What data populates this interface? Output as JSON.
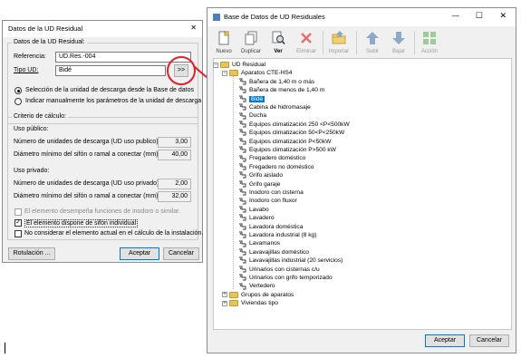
{
  "left_dialog": {
    "title": "Datos de la UD Residual",
    "close_glyph": "✕",
    "group_title": "Datos de la UD Residual:",
    "referencia_label": "Referencia:",
    "referencia_value": "UD.Res.-004",
    "tipo_label": "Tipo UD:",
    "tipo_value": "Bidé",
    "browse_label": ">>",
    "radio1": "Selección de la unidad de descarga desde la Base de datos",
    "radio2": "Indicar manualmente los parámetros de la unidad de descarga",
    "criterio_title": "Criterio de cálculo:",
    "uso_publico": "Uso público:",
    "pub_num_label": "Número de unidades de descarga (UD uso publico)",
    "pub_num_value": "3,00",
    "pub_diam_label": "Diámetro mínimo del sifón o ramal a conectar (mm):",
    "pub_diam_value": "40,00",
    "uso_privado": "Uso privado:",
    "priv_num_label": "Número de unidades de descarga (UD uso privado)",
    "priv_num_value": "2,00",
    "priv_diam_label": "Diámetro mínimo del sifón o ramal a conectar (mm):",
    "priv_diam_value": "32,00",
    "chk1": "El elemento desempeña funciones de inodoro o similar.",
    "chk2": "El elemento dispone de sifón individual",
    "chk3": "No considerar el elemento actual en el cálculo de la instalación.",
    "rotulacion": "Rotulación ...",
    "aceptar": "Aceptar",
    "cancelar": "Cancelar"
  },
  "right_dialog": {
    "title": "Base de Datos de UD Residuales",
    "win_min": "—",
    "win_max": "☐",
    "win_close": "✕",
    "toolbar": [
      {
        "label": "Nuevo",
        "icon": "new-doc-icon",
        "enabled": true
      },
      {
        "label": "Duplicar",
        "icon": "duplicate-icon",
        "enabled": true
      },
      {
        "label": "Ver",
        "icon": "magnifier-icon",
        "enabled": true
      },
      {
        "label": "Eliminar",
        "icon": "delete-x-icon",
        "enabled": false
      },
      {
        "label": "Importar",
        "icon": "import-folder-icon",
        "enabled": false
      },
      {
        "label": "Subir",
        "icon": "arrow-up-icon",
        "enabled": false
      },
      {
        "label": "Bajar",
        "icon": "arrow-down-icon",
        "enabled": false
      },
      {
        "label": "Acción",
        "icon": "action-grid-icon",
        "enabled": false
      }
    ],
    "tree_root": "UD Residual",
    "tree_group_open": "Aparatos CTE-HS4",
    "tree_items": [
      "Bañera de 1,40 m o más",
      "Bañera de menos de 1,40 m",
      "Bidé",
      "Cabina de hidromasaje",
      "Ducha",
      "Equipos climatización 250 <P<500kW",
      "Equipos climatización 50<P<250kW",
      "Equipos climatización P<50kW",
      "Equipos climatización P>500 kW",
      "Fregadero doméstico",
      "Fregadero no doméstico",
      "Grifo aislado",
      "Grifo garaje",
      "Inodoro con cisterna",
      "Inodoro con fluxor",
      "Lavabo",
      "Lavadero",
      "Lavadora doméstica",
      "Lavadora industrial (8 kg)",
      "Lavamanos",
      "Lavavajillas doméstico",
      "Lavavajillas industrial (20 servicios)",
      "Urinarios con cisternas c/u",
      "Urinarios con grifo temporizado",
      "Vertedero"
    ],
    "selected_item": "Bidé",
    "tree_closed_groups": [
      "Grupos de aparatos",
      "Viviendas tipo"
    ],
    "aceptar": "Aceptar",
    "cancelar": "Cancelar"
  },
  "colors": {
    "highlight_red": "#e0202a",
    "selection_blue": "#0078d7"
  }
}
